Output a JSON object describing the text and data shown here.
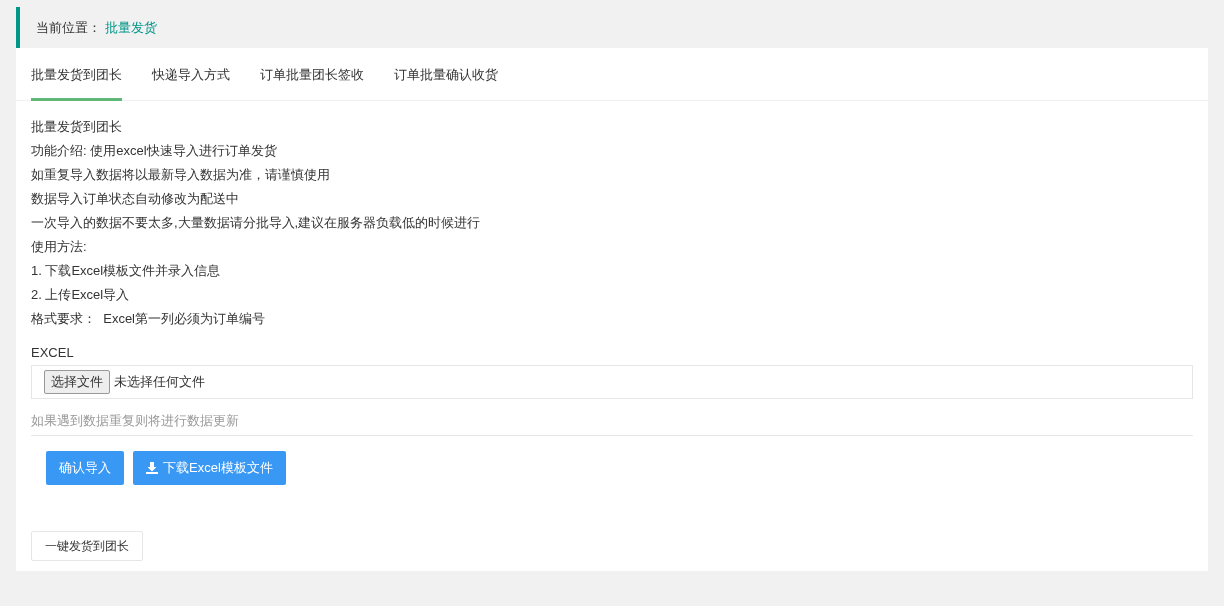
{
  "breadcrumb": {
    "label": "当前位置：",
    "current": "批量发货"
  },
  "tabs": [
    {
      "label": "批量发货到团长",
      "selected": true
    },
    {
      "label": "快递导入方式",
      "selected": false
    },
    {
      "label": "订单批量团长签收",
      "selected": false
    },
    {
      "label": "订单批量确认收货",
      "selected": false
    }
  ],
  "intro_lines": [
    "批量发货到团长",
    "功能介绍: 使用excel快速导入进行订单发货",
    "如重复导入数据将以最新导入数据为准，请谨慎使用",
    "数据导入订单状态自动修改为配送中",
    "一次导入的数据不要太多,大量数据请分批导入,建议在服务器负载低的时候进行",
    "使用方法:",
    "1. 下载Excel模板文件并录入信息",
    "2. 上传Excel导入",
    "格式要求：  Excel第一列必须为订单编号"
  ],
  "file_field": {
    "label": "EXCEL",
    "button": "选择文件",
    "status": "未选择任何文件"
  },
  "hint": "如果遇到数据重复则将进行数据更新",
  "buttons": [
    {
      "label": "确认导入",
      "kind": "primary"
    },
    {
      "label": "下载Excel模板文件",
      "kind": "download"
    }
  ],
  "bottom_button": "一键发货到团长"
}
